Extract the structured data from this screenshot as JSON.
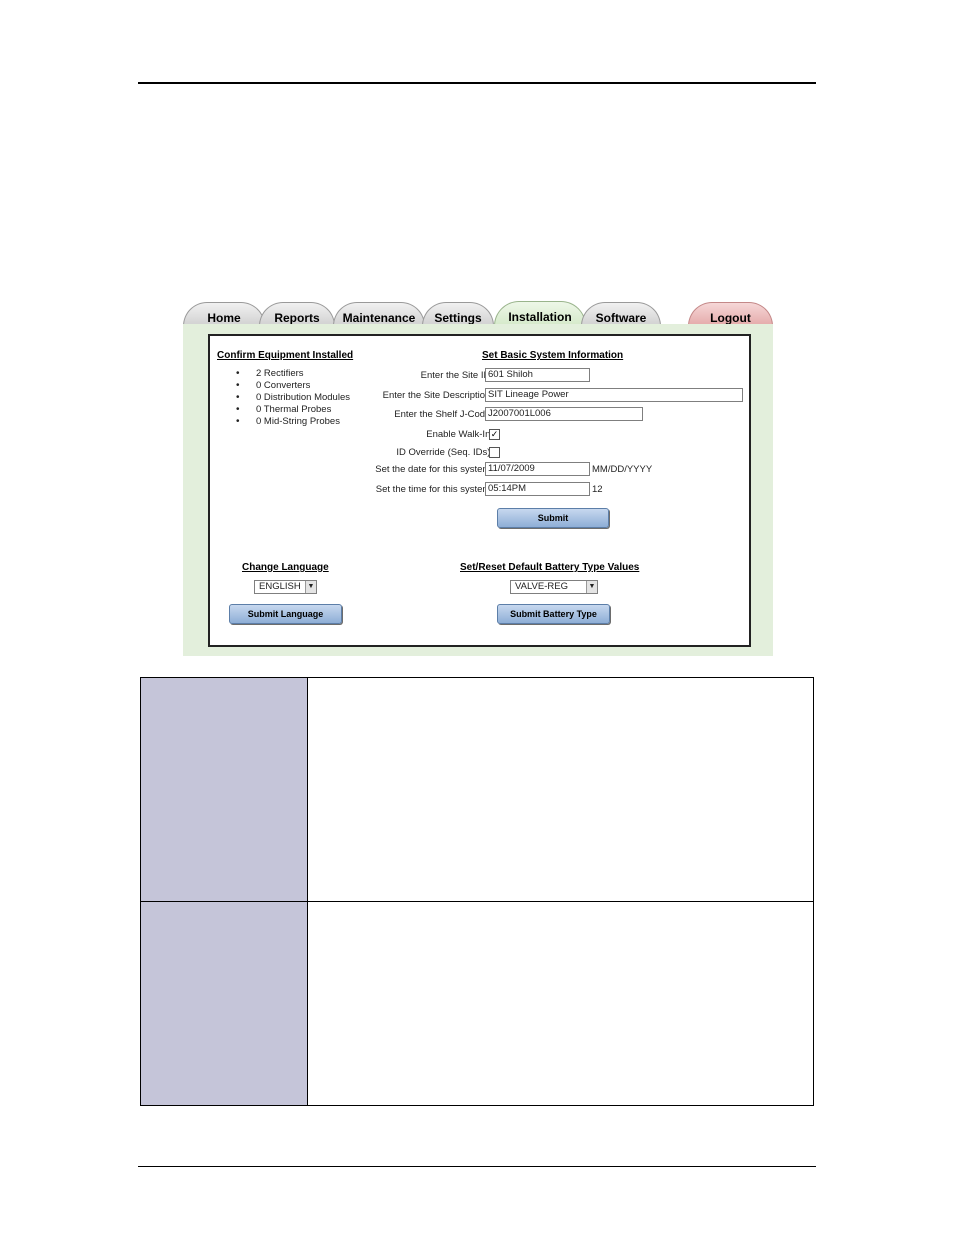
{
  "tabs": [
    {
      "label": "Home"
    },
    {
      "label": "Reports"
    },
    {
      "label": "Maintenance"
    },
    {
      "label": "Settings"
    },
    {
      "label": "Installation"
    },
    {
      "label": "Software"
    },
    {
      "label": "Logout"
    }
  ],
  "equipment": {
    "title": "Confirm Equipment Installed",
    "items": [
      "2 Rectifiers",
      "0 Converters",
      "0 Distribution Modules",
      "0 Thermal Probes",
      "0 Mid-String Probes"
    ]
  },
  "basic_info": {
    "title": "Set Basic System Information",
    "site_id_label": "Enter the Site ID:",
    "site_id_value": "601 Shiloh",
    "site_desc_label": "Enter the Site Description:",
    "site_desc_value": "SIT Lineage Power",
    "shelf_label": "Enter the Shelf J-Code:",
    "shelf_value": "J2007001L006",
    "walkin_label": "Enable Walk-In:",
    "walkin_checked": true,
    "override_label": "ID Override (Seq. IDs):",
    "override_checked": false,
    "date_label": "Set the date for this system:",
    "date_value": "11/07/2009",
    "date_format": "MM/DD/YYYY",
    "time_label": "Set the time for this system:",
    "time_value": "05:14PM",
    "time_suffix": "12",
    "submit_label": "Submit"
  },
  "language": {
    "title": "Change Language",
    "selected": "ENGLISH",
    "submit_label": "Submit Language"
  },
  "battery": {
    "title": "Set/Reset Default Battery Type Values",
    "selected": "VALVE-REG",
    "submit_label": "Submit Battery Type"
  },
  "icons": {
    "dropdown": "chevron-down-icon",
    "check": "check-icon"
  }
}
